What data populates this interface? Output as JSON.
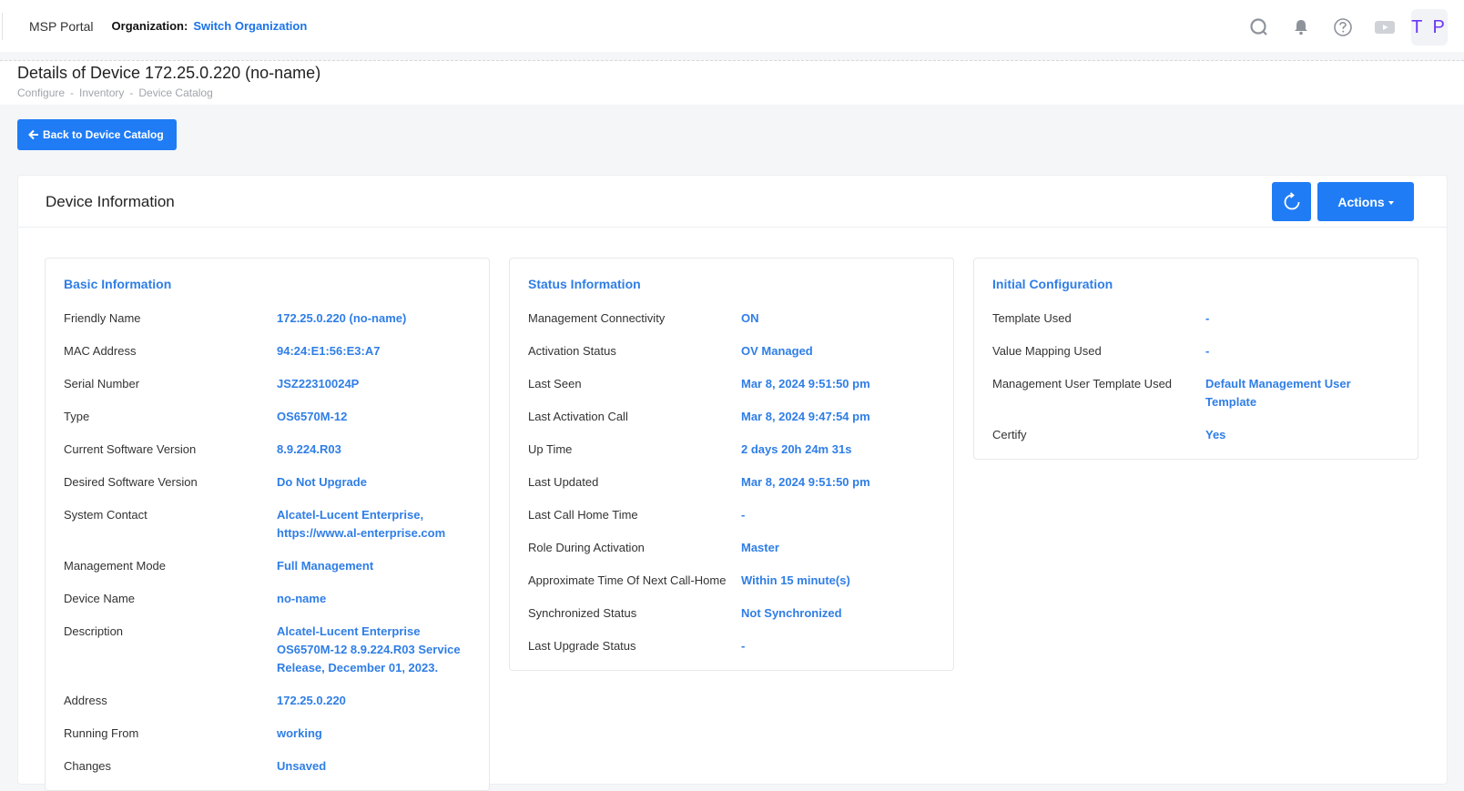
{
  "topbar": {
    "brand": "MSP Portal",
    "org_label": "Organization:",
    "org_link": "Switch Organization",
    "avatar": "T P",
    "icons": [
      "search-icon",
      "bell-icon",
      "help-icon",
      "video-icon"
    ]
  },
  "header": {
    "title": "Details of Device 172.25.0.220 (no-name)",
    "breadcrumbs": [
      "Configure",
      "Inventory",
      "Device Catalog"
    ],
    "sep": "-"
  },
  "back_button": "Back to Device Catalog",
  "card": {
    "title": "Device Information",
    "actions_label": "Actions"
  },
  "colors": {
    "accent": "#1f7cf5",
    "link": "#2f7ee6",
    "avatar": "#6a35f5"
  },
  "basic": {
    "title": "Basic Information",
    "rows": [
      {
        "label": "Friendly Name",
        "value": "172.25.0.220 (no-name)"
      },
      {
        "label": "MAC Address",
        "value": "94:24:E1:56:E3:A7"
      },
      {
        "label": "Serial Number",
        "value": "JSZ22310024P"
      },
      {
        "label": "Type",
        "value": "OS6570M-12"
      },
      {
        "label": "Current Software Version",
        "value": "8.9.224.R03"
      },
      {
        "label": "Desired Software Version",
        "value": "Do Not Upgrade"
      },
      {
        "label": "System Contact",
        "value": "Alcatel-Lucent Enterprise, https://www.al-enterprise.com"
      },
      {
        "label": "Management Mode",
        "value": "Full Management"
      },
      {
        "label": "Device Name",
        "value": "no-name"
      },
      {
        "label": "Description",
        "value": "Alcatel-Lucent Enterprise OS6570M-12 8.9.224.R03 Service Release, December 01, 2023."
      },
      {
        "label": "Address",
        "value": "172.25.0.220"
      },
      {
        "label": "Running From",
        "value": "working"
      },
      {
        "label": "Changes",
        "value": "Unsaved"
      }
    ]
  },
  "status": {
    "title": "Status Information",
    "rows": [
      {
        "label": "Management Connectivity",
        "value": "ON"
      },
      {
        "label": "Activation Status",
        "value": "OV Managed"
      },
      {
        "label": "Last Seen",
        "value": "Mar 8, 2024 9:51:50 pm"
      },
      {
        "label": "Last Activation Call",
        "value": "Mar 8, 2024 9:47:54 pm"
      },
      {
        "label": "Up Time",
        "value": "2 days 20h 24m 31s"
      },
      {
        "label": "Last Updated",
        "value": "Mar 8, 2024 9:51:50 pm"
      },
      {
        "label": "Last Call Home Time",
        "value": "-"
      },
      {
        "label": "Role During Activation",
        "value": "Master"
      },
      {
        "label": "Approximate Time Of Next Call-Home",
        "value": "Within 15 minute(s)"
      },
      {
        "label": "Synchronized Status",
        "value": "Not Synchronized"
      },
      {
        "label": "Last Upgrade Status",
        "value": "-"
      }
    ]
  },
  "initial": {
    "title": "Initial Configuration",
    "rows": [
      {
        "label": "Template Used",
        "value": "-"
      },
      {
        "label": "Value Mapping Used",
        "value": "-"
      },
      {
        "label": "Management User Template Used",
        "value": "Default Management User Template"
      },
      {
        "label": "Certify",
        "value": "Yes"
      }
    ]
  }
}
